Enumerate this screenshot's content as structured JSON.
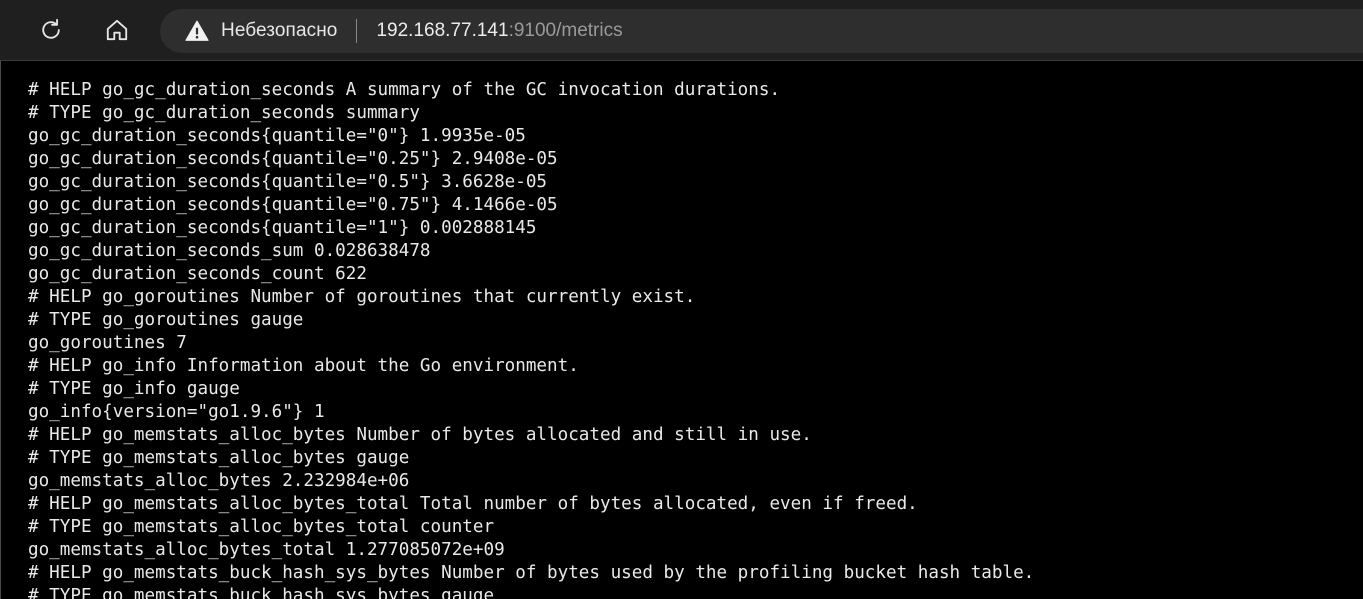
{
  "toolbar": {
    "reload_icon": "reload-icon",
    "home_icon": "home-icon"
  },
  "address_bar": {
    "security_icon": "warning-icon",
    "security_label": "Небезопасно",
    "url_host": "192.168.77.141",
    "url_rest": ":9100/metrics"
  },
  "colors": {
    "page_background": "#000000",
    "toolbar_background": "#1f1f1f",
    "omnibox_background": "#2e2e2e",
    "text": "#e9e9e9",
    "url_muted": "#9a9a9a"
  },
  "page": {
    "lines": [
      "# HELP go_gc_duration_seconds A summary of the GC invocation durations.",
      "# TYPE go_gc_duration_seconds summary",
      "go_gc_duration_seconds{quantile=\"0\"} 1.9935e-05",
      "go_gc_duration_seconds{quantile=\"0.25\"} 2.9408e-05",
      "go_gc_duration_seconds{quantile=\"0.5\"} 3.6628e-05",
      "go_gc_duration_seconds{quantile=\"0.75\"} 4.1466e-05",
      "go_gc_duration_seconds{quantile=\"1\"} 0.002888145",
      "go_gc_duration_seconds_sum 0.028638478",
      "go_gc_duration_seconds_count 622",
      "# HELP go_goroutines Number of goroutines that currently exist.",
      "# TYPE go_goroutines gauge",
      "go_goroutines 7",
      "# HELP go_info Information about the Go environment.",
      "# TYPE go_info gauge",
      "go_info{version=\"go1.9.6\"} 1",
      "# HELP go_memstats_alloc_bytes Number of bytes allocated and still in use.",
      "# TYPE go_memstats_alloc_bytes gauge",
      "go_memstats_alloc_bytes 2.232984e+06",
      "# HELP go_memstats_alloc_bytes_total Total number of bytes allocated, even if freed.",
      "# TYPE go_memstats_alloc_bytes_total counter",
      "go_memstats_alloc_bytes_total 1.277085072e+09",
      "# HELP go_memstats_buck_hash_sys_bytes Number of bytes used by the profiling bucket hash table.",
      "# TYPE go_memstats_buck_hash_sys_bytes gauge"
    ]
  }
}
